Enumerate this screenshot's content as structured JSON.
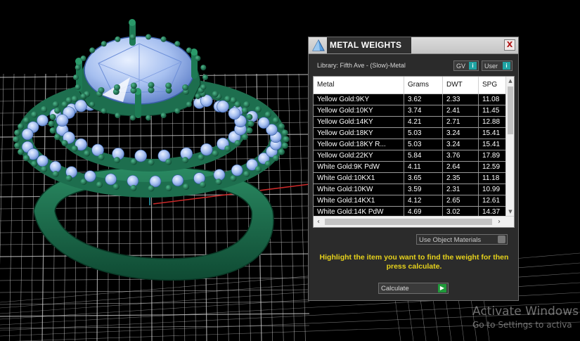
{
  "panel": {
    "title": "METAL WEIGHTS",
    "close_label": "X",
    "library_label": "Library: Fifth Ave - (Slow)-Metal",
    "toggles": [
      {
        "label": "GV",
        "icon": "info-icon",
        "info_label": "i"
      },
      {
        "label": "User",
        "icon": "info-icon",
        "info_label": "i"
      }
    ],
    "table": {
      "columns": [
        "Metal",
        "Grams",
        "DWT",
        "SPG"
      ],
      "rows": [
        {
          "metal": "Yellow Gold:9KY",
          "grams": "3.62",
          "dwt": "2.33",
          "spg": "11.08"
        },
        {
          "metal": "Yellow Gold:10KY",
          "grams": "3.74",
          "dwt": "2.41",
          "spg": "11.45"
        },
        {
          "metal": "Yellow Gold:14KY",
          "grams": "4.21",
          "dwt": "2.71",
          "spg": "12.88"
        },
        {
          "metal": "Yellow Gold:18KY",
          "grams": "5.03",
          "dwt": "3.24",
          "spg": "15.41"
        },
        {
          "metal": "Yellow Gold:18KY R...",
          "grams": "5.03",
          "dwt": "3.24",
          "spg": "15.41"
        },
        {
          "metal": "Yellow Gold:22KY",
          "grams": "5.84",
          "dwt": "3.76",
          "spg": "17.89"
        },
        {
          "metal": "White Gold:9K PdW",
          "grams": "4.11",
          "dwt": "2.64",
          "spg": "12.59"
        },
        {
          "metal": "White Gold:10KX1",
          "grams": "3.65",
          "dwt": "2.35",
          "spg": "11.18"
        },
        {
          "metal": "White Gold:10KW",
          "grams": "3.59",
          "dwt": "2.31",
          "spg": "10.99"
        },
        {
          "metal": "White Gold:14KX1",
          "grams": "4.12",
          "dwt": "2.65",
          "spg": "12.61"
        },
        {
          "metal": "White Gold:14K PdW",
          "grams": "4.69",
          "dwt": "3.02",
          "spg": "14.37"
        }
      ]
    },
    "use_materials_label": "Use Object Materials",
    "instructions": "Highlight the item you want to find the weight for then press calculate.",
    "calculate_label": "Calculate"
  },
  "watermark": {
    "line1": "Activate Windows",
    "line2": "Go to Settings to activa"
  },
  "colors": {
    "ring": "#1d6e4e",
    "gems": "#a9c3f2",
    "grid": "#d9d9d9",
    "instructions": "#e6d21c"
  }
}
